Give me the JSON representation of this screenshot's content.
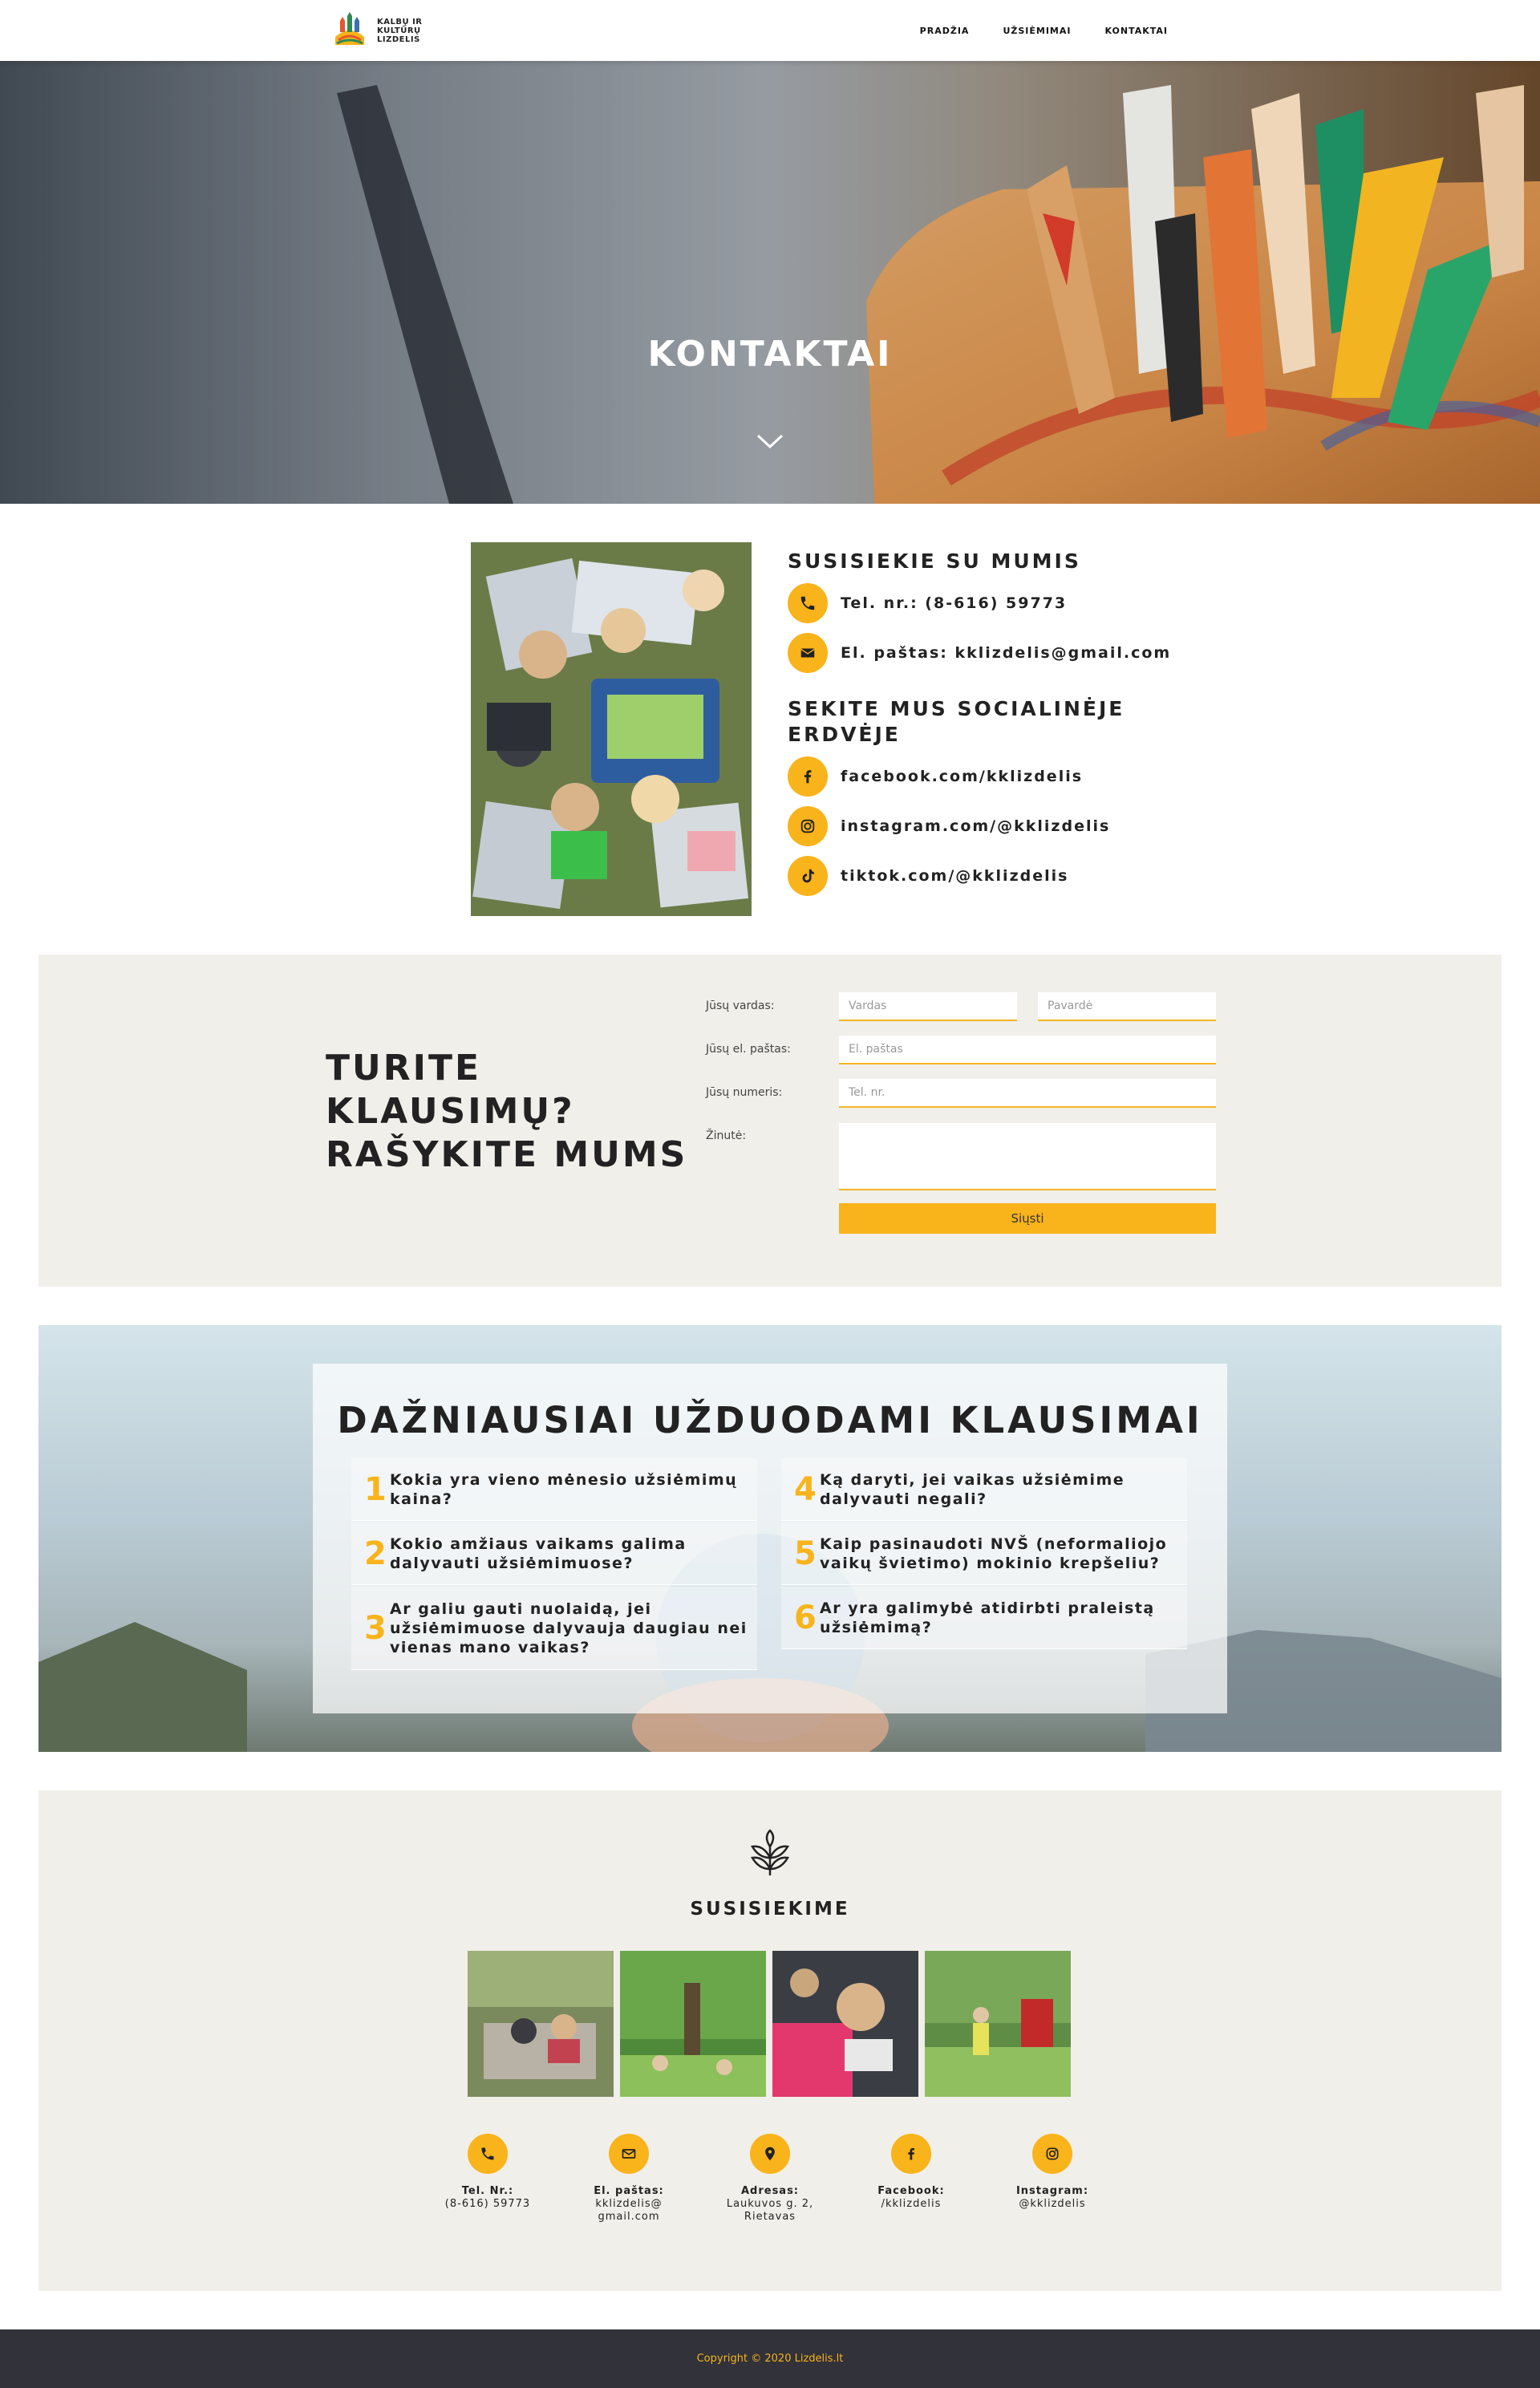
{
  "brand": {
    "logo_lines": [
      "KALBŲ IR",
      "KULTŪRŲ",
      "LIZDELIS"
    ],
    "accent": "#f9b31b",
    "dark": "#31323a",
    "section_bg": "#f1efe9"
  },
  "nav": {
    "items": [
      "PRADŽIA",
      "UŽSIĖMIMAI",
      "KONTAKTAI"
    ]
  },
  "hero": {
    "title": "KONTAKTAI",
    "chevron_icon": "chevron-down-icon"
  },
  "contact": {
    "heading": "SUSISIEKIE SU MUMIS",
    "phone": "Tel. nr.: (8-616) 59773",
    "email": "El. paštas: kklizdelis@gmail.com",
    "social_heading": "SEKITE MUS SOCIALINĖJE ERDVĖJE",
    "facebook": "facebook.com/kklizdelis",
    "instagram": "instagram.com/@kklizdelis",
    "tiktok": "tiktok.com/@kklizdelis"
  },
  "form": {
    "title_lines": [
      "TURITE",
      "KLAUSIMŲ?",
      "RAŠYKITE MUMS"
    ],
    "name_label": "Jūsų vardas:",
    "first_name_placeholder": "Vardas",
    "last_name_placeholder": "Pavardė",
    "email_label": "Jūsų el. paštas:",
    "email_placeholder": "El. paštas",
    "phone_label": "Jūsų numeris:",
    "phone_placeholder": "Tel. nr.",
    "message_label": "Žinutė:",
    "submit_label": "Siųsti"
  },
  "faq": {
    "title": "DAŽNIAUSIAI UŽDUODAMI KLAUSIMAI",
    "items": [
      {
        "num": "1",
        "q": "Kokia yra vieno mėnesio užsiėmimų kaina?"
      },
      {
        "num": "2",
        "q": "Kokio amžiaus vaikams galima dalyvauti užsiėmimuose?"
      },
      {
        "num": "3",
        "q": "Ar galiu gauti nuolaidą, jei užsiėmimuose dalyvauja daugiau nei vienas mano vaikas?"
      },
      {
        "num": "4",
        "q": "Ką daryti, jei vaikas užsiėmime dalyvauti negali?"
      },
      {
        "num": "5",
        "q": "Kaip pasinaudoti NVŠ (neformaliojo vaikų švietimo) mokinio krepšeliu?"
      },
      {
        "num": "6",
        "q": "Ar yra galimybė atidirbti praleistą užsiėmimą?"
      }
    ]
  },
  "susisiekime": {
    "title": "SUSISIEKIME",
    "items": [
      {
        "label": "Tel. Nr.:",
        "value_lines": [
          "(8-616) 59773"
        ],
        "icon": "phone-icon"
      },
      {
        "label": "El. paštas:",
        "value_lines": [
          "kklizdelis@",
          "gmail.com"
        ],
        "icon": "envelope-icon"
      },
      {
        "label": "Adresas:",
        "value_lines": [
          "Laukuvos g. 2,",
          "Rietavas"
        ],
        "icon": "map-pin-icon"
      },
      {
        "label": "Facebook:",
        "value_lines": [
          "/kklizdelis"
        ],
        "icon": "facebook-icon"
      },
      {
        "label": "Instagram:",
        "value_lines": [
          "@kklizdelis"
        ],
        "icon": "instagram-icon"
      }
    ]
  },
  "footer": {
    "copyright": "Copyright © 2020 Lizdelis.lt"
  }
}
